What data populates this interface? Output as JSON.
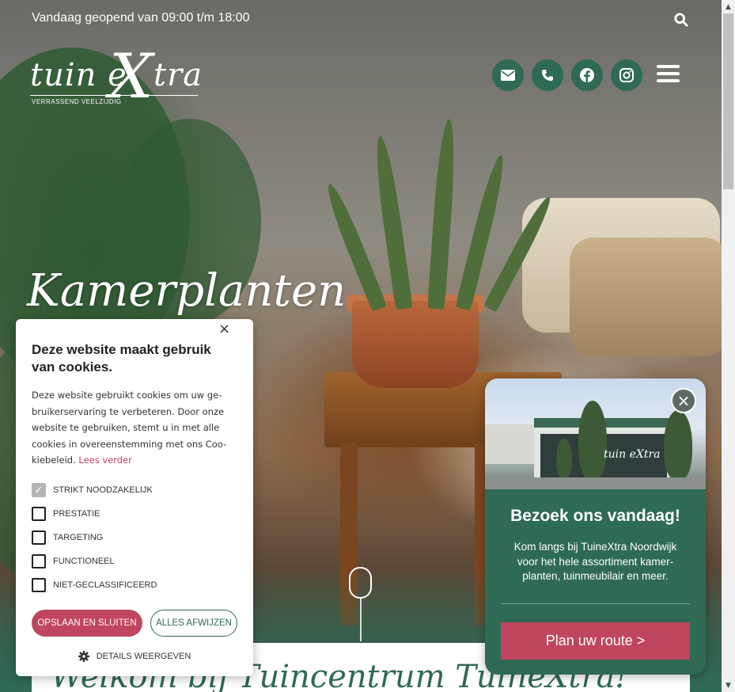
{
  "topbar": {
    "opening_hours": "Vandaag geopend van 09:00 t/m 18:00"
  },
  "logo": {
    "word_left": "tuin e",
    "word_x": "X",
    "word_right": "tra",
    "tagline": "VERRASSEND VEELZIJDIG"
  },
  "header": {
    "social": [
      {
        "icon": "envelope-icon"
      },
      {
        "icon": "phone-icon"
      },
      {
        "icon": "facebook-icon"
      },
      {
        "icon": "instagram-icon"
      }
    ]
  },
  "hero": {
    "title": "Kamerplanten"
  },
  "welcome": {
    "title": "Welkom bij Tuincentrum TuineXtra!"
  },
  "cookie": {
    "title": "Deze website maakt gebruik van cookies.",
    "body": "Deze website gebruikt cookies om uw ge-bruikerservaring te verbeteren. Door onze website te gebruiken, stemt u in met alle cookies in overeenstemming met ons Coo-kiebeleid.",
    "read_more": "Lees verder",
    "options": [
      {
        "label": "STRIKT NOODZAKELIJK",
        "checked": true
      },
      {
        "label": "PRESTATIE",
        "checked": false
      },
      {
        "label": "TARGETING",
        "checked": false
      },
      {
        "label": "FUNCTIONEEL",
        "checked": false
      },
      {
        "label": "NIET-GECLASSIFICEERD",
        "checked": false
      }
    ],
    "save_label": "OPSLAAN EN SLUITEN",
    "reject_label": "ALLES AFWIJZEN",
    "details_label": "DETAILS WEERGEVEN",
    "close": "×"
  },
  "visit": {
    "photo_sign": "tuin eXtra",
    "title": "Bezoek ons vandaag!",
    "text": "Kom langs bij TuineXtra Noordwijk voor het hele assortiment kamer-planten, tuinmeubilair en meer.",
    "button": "Plan uw route >",
    "close": "×"
  },
  "colors": {
    "brand_green": "#2f6a55",
    "accent_pink": "#c0455e"
  }
}
